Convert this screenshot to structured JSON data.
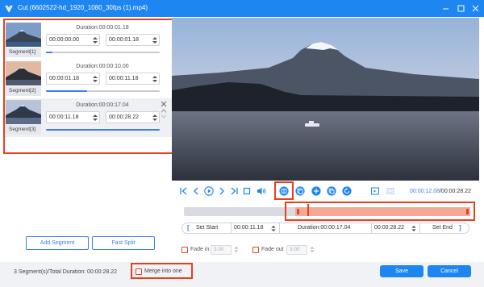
{
  "window": {
    "title": "Cut (6602522-hd_1920_1080_30fps (1).mp4)"
  },
  "segments": [
    {
      "label": "Segment[1]",
      "duration": "Duration:00:00:01.18",
      "start": "00:00:00.00",
      "end": "00:00:01.18",
      "progress": 0.06
    },
    {
      "label": "Segment[2]",
      "duration": "Duration:00:00:10.00",
      "start": "00:00:01.18",
      "end": "00:00:11.18",
      "progress": 0.36
    },
    {
      "label": "Segment[3]",
      "duration": "Duration:00:00:17.04",
      "start": "00:00:11.18",
      "end": "00:00:28.22",
      "progress": 1.0
    }
  ],
  "left_actions": {
    "add_segment": "Add Segment",
    "fast_split": "Fast Split"
  },
  "player": {
    "current_time": "00:00:12.08",
    "total_time": "/00:00:28.22",
    "playhead_fraction": 0.43,
    "selection_start_fraction": 0.39
  },
  "range": {
    "set_start": "Set Start",
    "start_value": "00:00:11.18",
    "duration": "Duration:00:00:17.04",
    "end_value": "00:00:28.22",
    "set_end": "Set End"
  },
  "fades": {
    "fade_in_label": "Fade in",
    "fade_in_value": "3.00",
    "fade_out_label": "Fade out",
    "fade_out_value": "3.00"
  },
  "footer": {
    "status": "3 Segment(s)/Total Duration: 00:00:28.22",
    "merge_label": "Merge into one",
    "save": "Save",
    "cancel": "Cancel"
  },
  "colors": {
    "accent": "#1e86f0",
    "highlight": "#e8401c",
    "selection": "#f4a996"
  }
}
